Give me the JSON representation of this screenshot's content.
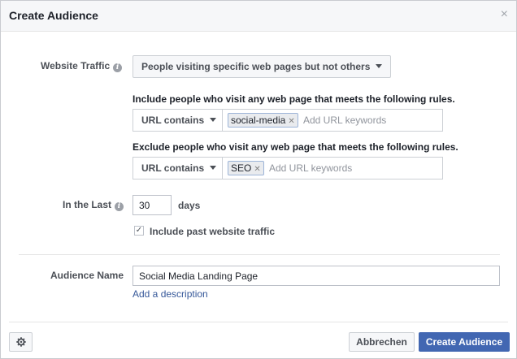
{
  "dialog": {
    "title": "Create Audience",
    "close_glyph": "×"
  },
  "website_traffic": {
    "label": "Website Traffic",
    "selected_option": "People visiting specific web pages but not others"
  },
  "include_rule": {
    "heading": "Include people who visit any web page that meets the following rules.",
    "condition": "URL contains",
    "keywords": [
      "social-media"
    ],
    "placeholder": "Add URL keywords"
  },
  "exclude_rule": {
    "heading": "Exclude people who visit any web page that meets the following rules.",
    "condition": "URL contains",
    "keywords": [
      "SEO"
    ],
    "placeholder": "Add URL keywords"
  },
  "in_the_last": {
    "label": "In the Last",
    "value": "30",
    "unit": "days"
  },
  "past_traffic": {
    "label": "Include past website traffic",
    "checked": true
  },
  "audience_name": {
    "label": "Audience Name",
    "value": "Social Media Landing Page",
    "add_description": "Add a description"
  },
  "footer": {
    "cancel_label": "Abbrechen",
    "create_label": "Create Audience",
    "settings_icon": "gear-icon"
  },
  "colors": {
    "primary": "#4267b2",
    "link": "#365899"
  }
}
